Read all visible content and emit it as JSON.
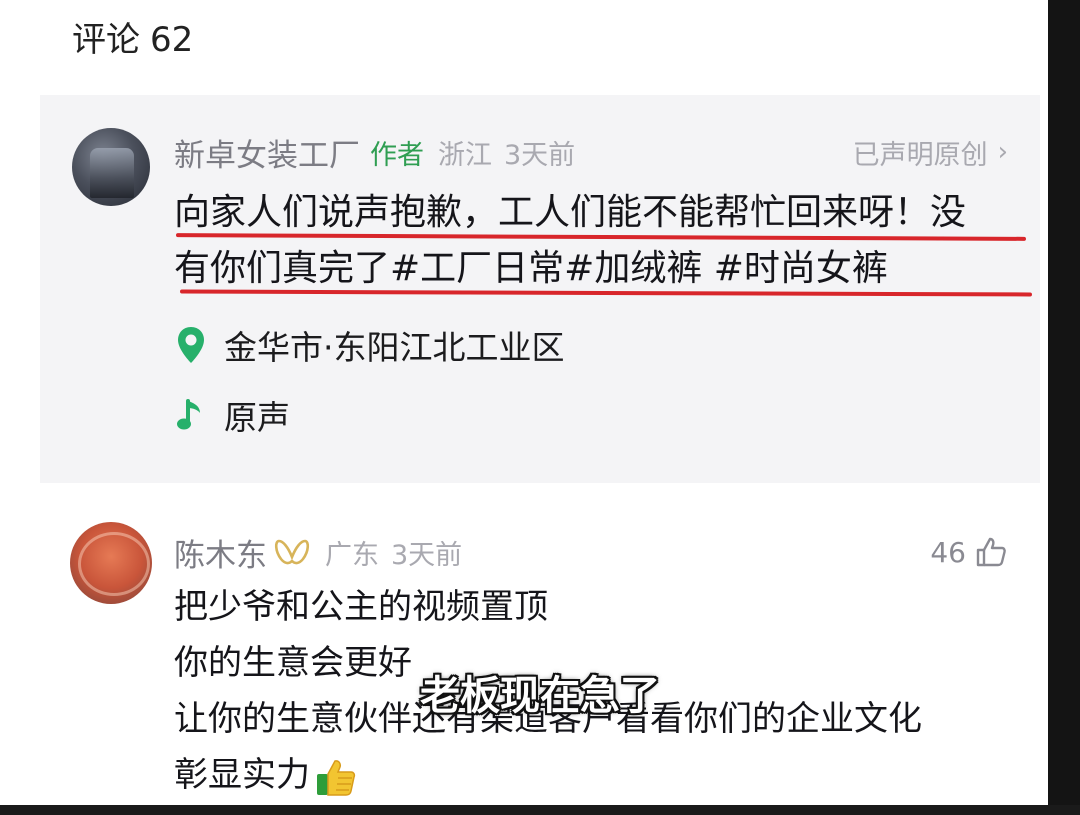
{
  "header": {
    "label": "评论",
    "count": "62"
  },
  "author_comment": {
    "name": "新卓女装工厂",
    "tag": "作者",
    "region": "浙江",
    "time": "3天前",
    "declared": "已声明原创",
    "declared_chevron": "›",
    "text_line1": "向家人们说声抱歉，工人们能不能帮忙回来呀！没",
    "text_line2": "有你们真完了#工厂日常#加绒裤 #时尚女裤",
    "location": "金华市·东阳江北工业区",
    "location_icon": "map-pin-icon",
    "sound": "原声",
    "sound_icon": "music-note-icon",
    "highlight_color": "#d8262b",
    "tag_color": "#2f9e52"
  },
  "user_comment": {
    "name": "陈木东",
    "badge_icon": "vip-badge-icon",
    "region": "广东",
    "time": "3天前",
    "likes": "46",
    "like_icon": "thumbs-up-icon",
    "lines": [
      "把少爷和公主的视频置顶",
      "你的生意会更好",
      "让你的生意伙伴还有渠道客户看看你们的企业文化",
      "彰显实力"
    ],
    "emoji": "thumbs-up-emoji"
  },
  "overlay": {
    "subtitle": "老板现在急了"
  }
}
